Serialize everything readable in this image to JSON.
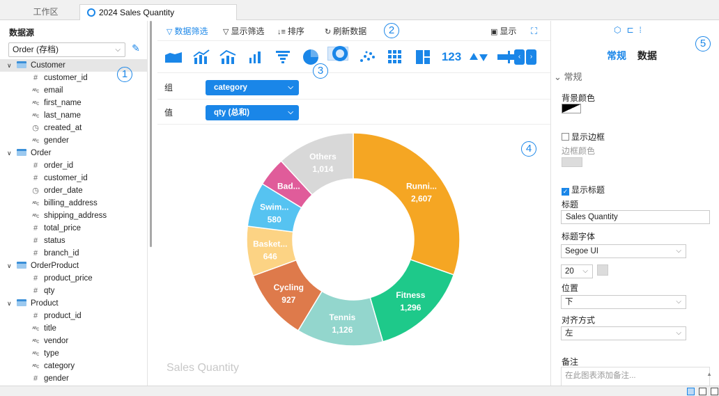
{
  "tabs": {
    "inactive": "工作区",
    "active": "2024 Sales Quantity"
  },
  "datasource": {
    "title": "数据源",
    "selected": "Order (存档)",
    "tables": [
      {
        "name": "Customer",
        "fields": [
          {
            "type": "num",
            "name": "customer_id"
          },
          {
            "type": "str",
            "name": "email"
          },
          {
            "type": "str",
            "name": "first_name"
          },
          {
            "type": "str",
            "name": "last_name"
          },
          {
            "type": "time",
            "name": "created_at"
          },
          {
            "type": "str",
            "name": "gender"
          }
        ]
      },
      {
        "name": "Order",
        "fields": [
          {
            "type": "num",
            "name": "order_id"
          },
          {
            "type": "num",
            "name": "customer_id"
          },
          {
            "type": "time",
            "name": "order_date"
          },
          {
            "type": "str",
            "name": "billing_address"
          },
          {
            "type": "str",
            "name": "shipping_address"
          },
          {
            "type": "num",
            "name": "total_price"
          },
          {
            "type": "num",
            "name": "status"
          },
          {
            "type": "num",
            "name": "branch_id"
          }
        ]
      },
      {
        "name": "OrderProduct",
        "fields": [
          {
            "type": "num",
            "name": "product_price"
          },
          {
            "type": "num",
            "name": "qty"
          }
        ]
      },
      {
        "name": "Product",
        "fields": [
          {
            "type": "num",
            "name": "product_id"
          },
          {
            "type": "str",
            "name": "title"
          },
          {
            "type": "str",
            "name": "vendor"
          },
          {
            "type": "str",
            "name": "type"
          },
          {
            "type": "str",
            "name": "category"
          },
          {
            "type": "num",
            "name": "gender"
          }
        ]
      }
    ]
  },
  "callouts": [
    "1",
    "2",
    "3",
    "4",
    "5"
  ],
  "toolbar": {
    "data_filter": "数据筛选",
    "display_filter": "显示筛选",
    "sort": "排序",
    "refresh": "刷新数据",
    "display": "显示"
  },
  "chart_types": {
    "number_label": "123"
  },
  "fields": {
    "group_label": "组",
    "group_value": "category",
    "value_label": "值",
    "value_value": "qty (总和)"
  },
  "chart_data": {
    "type": "pie",
    "title": "Sales Quantity",
    "donut": true,
    "slices": [
      {
        "label": "Runni...",
        "value": 2607,
        "display": "2,607",
        "color": "#f5a623"
      },
      {
        "label": "Fitness",
        "value": 1296,
        "display": "1,296",
        "color": "#1ec98a"
      },
      {
        "label": "Tennis",
        "value": 1126,
        "display": "1,126",
        "color": "#93d6cd"
      },
      {
        "label": "Cycling",
        "value": 927,
        "display": "927",
        "color": "#de7a4b"
      },
      {
        "label": "Basket...",
        "value": 646,
        "display": "646",
        "color": "#fcd384"
      },
      {
        "label": "Swim...",
        "value": 580,
        "display": "580",
        "color": "#56c3f1"
      },
      {
        "label": "Bad...",
        "value": 380,
        "display": "",
        "color": "#e05c9a"
      },
      {
        "label": "Others",
        "value": 1014,
        "display": "1,014",
        "color": "#d8d8d8"
      }
    ]
  },
  "props": {
    "tab_general": "常规",
    "tab_data": "数据",
    "section": "常规",
    "bg_color": "背景颜色",
    "show_border": "显示边框",
    "border_color": "边框颜色",
    "show_title": "显示标题",
    "title_label": "标题",
    "title_value": "Sales Quantity",
    "title_font_label": "标题字体",
    "title_font_value": "Segoe UI",
    "font_size": "20",
    "position_label": "位置",
    "position_value": "下",
    "align_label": "对齐方式",
    "align_value": "左",
    "note_label": "备注",
    "note_placeholder": "在此图表添加备注..."
  }
}
